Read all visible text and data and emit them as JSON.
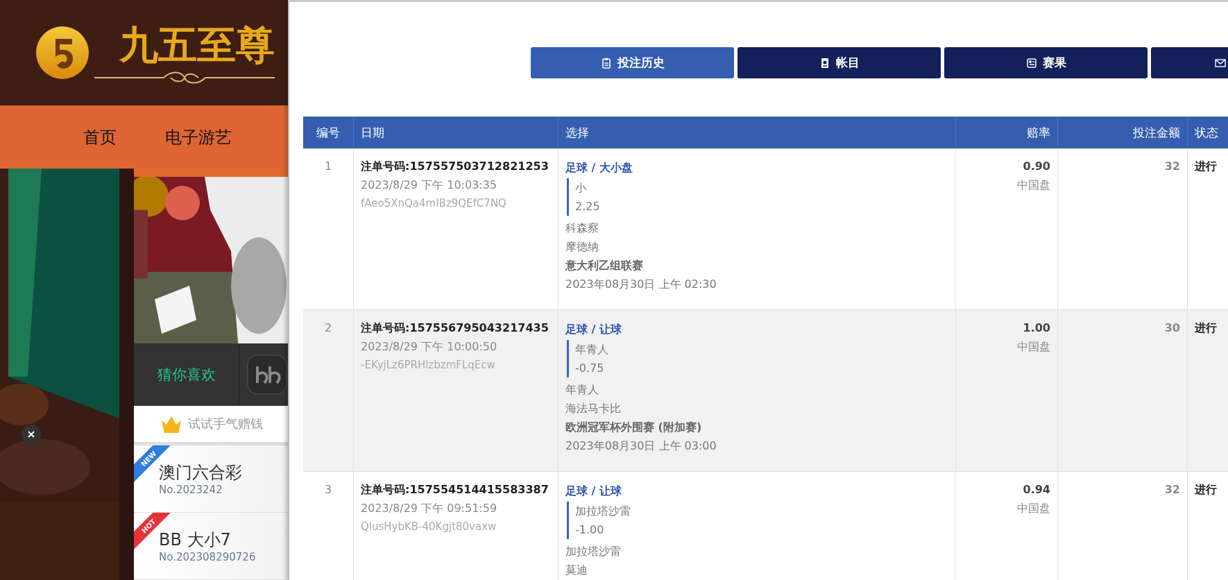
{
  "site": {
    "logo_text": "九五至尊",
    "nav": [
      {
        "label": "首页"
      },
      {
        "label": "电子游艺"
      }
    ],
    "promo_bar": {
      "label": "猜你喜欢"
    },
    "hint": "试试手气赠钱",
    "games": [
      {
        "badge": "NEW",
        "color": "#2f7de1",
        "name": "澳门六合彩",
        "draw": "No.2023242"
      },
      {
        "badge": "HOT",
        "color": "#e8323a",
        "name": "BB 大小7",
        "draw": "No.202308290726"
      }
    ]
  },
  "tabs": [
    {
      "label": "投注历史",
      "kind": "clipboard",
      "selected": true
    },
    {
      "label": "帐目",
      "kind": "ledger",
      "selected": false
    },
    {
      "label": "赛果",
      "kind": "results",
      "selected": false
    },
    {
      "kind": "mail",
      "selected": false
    }
  ],
  "table": {
    "columns": [
      "编号",
      "日期",
      "选择",
      "赔率",
      "投注金额",
      "状态"
    ],
    "rows": [
      {
        "number": "1",
        "order_no": "注单号码:157557503712821253",
        "date": "2023/8/29 下午 10:03:35",
        "token": "fAeo5XnQa4mIBz9QEfC7NQ",
        "market": "足球 / 大小盘",
        "pick": "小",
        "line": "2.25",
        "home": "科森察",
        "away": "摩德纳",
        "league": "意大利乙组联赛",
        "kickoff": "2023年08月30日 上午 02:30",
        "odds": "0.90",
        "odds_type": "中国盘",
        "stake": "32",
        "status": "进行"
      },
      {
        "number": "2",
        "order_no": "注单号码:157556795043217435",
        "date": "2023/8/29 下午 10:00:50",
        "token": "-EKyjLz6PRHlzbzmFLqEcw",
        "market": "足球 / 让球",
        "pick": "年青人",
        "line": "-0.75",
        "home": "年青人",
        "away": "海法马卡比",
        "league": "欧洲冠军杯外围赛 (附加赛)",
        "kickoff": "2023年08月30日 上午 03:00",
        "odds": "1.00",
        "odds_type": "中国盘",
        "stake": "30",
        "status": "进行"
      },
      {
        "number": "3",
        "order_no": "注单号码:157554514415583387",
        "date": "2023/8/29 下午 09:51:59",
        "token": "QlusHybKB-40Kgjt80vaxw",
        "market": "足球 / 让球",
        "pick": "加拉塔沙雷",
        "line": "-1.00",
        "home": "加拉塔沙雷",
        "away": "莫迪",
        "odds": "0.94",
        "odds_type": "中国盘",
        "stake": "32",
        "status": "进行"
      }
    ]
  }
}
